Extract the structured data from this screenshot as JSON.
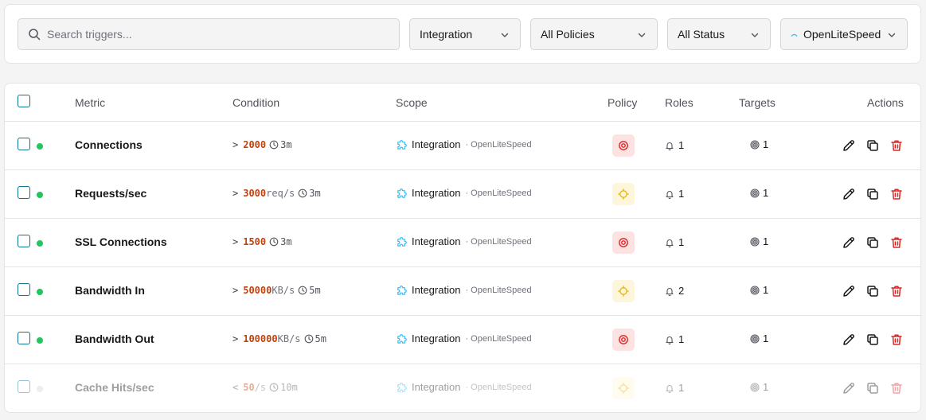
{
  "filters": {
    "search_placeholder": "Search triggers...",
    "scope_select": "Integration",
    "policy_select": "All Policies",
    "status_select": "All Status",
    "integration_select": "OpenLiteSpeed"
  },
  "table": {
    "headers": {
      "metric": "Metric",
      "condition": "Condition",
      "scope": "Scope",
      "policy": "Policy",
      "roles": "Roles",
      "targets": "Targets",
      "actions": "Actions"
    },
    "rows": [
      {
        "metric": "Connections",
        "operator": ">",
        "threshold": "2000",
        "unit": "",
        "duration": "3m",
        "scope_label": "Integration",
        "scope_target": "· OpenLiteSpeed",
        "policy": "critical",
        "roles": "1",
        "targets": "1",
        "enabled": true
      },
      {
        "metric": "Requests/sec",
        "operator": ">",
        "threshold": "3000",
        "unit": "req/s",
        "duration": "3m",
        "scope_label": "Integration",
        "scope_target": "· OpenLiteSpeed",
        "policy": "warning",
        "roles": "1",
        "targets": "1",
        "enabled": true
      },
      {
        "metric": "SSL Connections",
        "operator": ">",
        "threshold": "1500",
        "unit": "",
        "duration": "3m",
        "scope_label": "Integration",
        "scope_target": "· OpenLiteSpeed",
        "policy": "critical",
        "roles": "1",
        "targets": "1",
        "enabled": true
      },
      {
        "metric": "Bandwidth In",
        "operator": ">",
        "threshold": "50000",
        "unit": "KB/s",
        "duration": "5m",
        "scope_label": "Integration",
        "scope_target": "· OpenLiteSpeed",
        "policy": "warning",
        "roles": "2",
        "targets": "1",
        "enabled": true
      },
      {
        "metric": "Bandwidth Out",
        "operator": ">",
        "threshold": "100000",
        "unit": "KB/s",
        "duration": "5m",
        "scope_label": "Integration",
        "scope_target": "· OpenLiteSpeed",
        "policy": "critical",
        "roles": "1",
        "targets": "1",
        "enabled": true
      },
      {
        "metric": "Cache Hits/sec",
        "operator": "<",
        "threshold": "50",
        "unit": "/s",
        "duration": "10m",
        "scope_label": "Integration",
        "scope_target": "· OpenLiteSpeed",
        "policy": "warning",
        "roles": "1",
        "targets": "1",
        "enabled": false
      }
    ]
  },
  "colors": {
    "accent": "#0e7490",
    "status_active": "#22c55e",
    "status_inactive": "#d4d4d8",
    "threshold": "#c2410c",
    "policy_critical": "#dc2626",
    "policy_warning": "#eab308",
    "delete": "#dc2626",
    "integration_icon": "#38bdf8"
  },
  "icons": {
    "search": "search-icon",
    "chevron": "chevron-down-icon",
    "clock": "clock-icon",
    "scope": "puzzle-icon",
    "policy_critical": "target-icon",
    "policy_warning": "sun-icon",
    "roles": "bell-icon",
    "targets": "radar-icon",
    "edit": "pencil-icon",
    "duplicate": "copy-icon",
    "delete": "trash-icon"
  }
}
